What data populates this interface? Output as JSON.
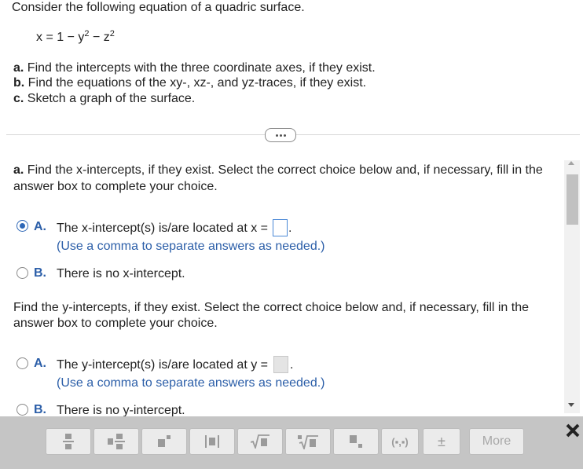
{
  "problem": {
    "intro": "Consider the following equation of a quadric surface.",
    "equation": {
      "lhs": "x = 1 − y",
      "exp1": "2",
      "mid": " − z",
      "exp2": "2"
    },
    "parts": [
      {
        "label": "a.",
        "text": " Find the intercepts with the three coordinate axes, if they exist."
      },
      {
        "label": "b.",
        "text": " Find the equations of the xy-, xz-, and yz-traces, if they exist."
      },
      {
        "label": "c.",
        "text": " Sketch a graph of the surface."
      }
    ]
  },
  "question_a": {
    "prompt_label": "a.",
    "prompt_line1": " Find the x-intercepts, if they exist. Select the correct choice below and, if necessary, fill in the",
    "prompt_line2": "answer box to complete your choice.",
    "options": [
      {
        "letter": "A.",
        "text": "The x-intercept(s) is/are located at x =",
        "hint": "(Use a comma to separate answers as needed.)",
        "selected": true
      },
      {
        "letter": "B.",
        "text": "There is no x-intercept.",
        "selected": false
      }
    ]
  },
  "question_y": {
    "prompt_line1": "Find the y-intercepts, if they exist. Select the correct choice below and, if necessary, fill in the",
    "prompt_line2": "answer box to complete your choice.",
    "options": [
      {
        "letter": "A.",
        "text": "The y-intercept(s) is/are located at y =",
        "hint": "(Use a comma to separate answers as needed.)",
        "selected": false
      },
      {
        "letter": "B.",
        "text": "There is no y-intercept.",
        "selected": false
      }
    ]
  },
  "toolbar": {
    "buttons": [
      "fraction",
      "mixed-number",
      "exponent",
      "absolute-value",
      "square-root",
      "nth-root",
      "subscript",
      "ordered-pair",
      "plus-minus"
    ],
    "plus_minus": "±",
    "ordered_pair": "(▪,▪)",
    "more_label": "More",
    "close": "✖"
  },
  "colors": {
    "accent": "#2b5ea8",
    "toolbar": "#c5c5c5"
  }
}
